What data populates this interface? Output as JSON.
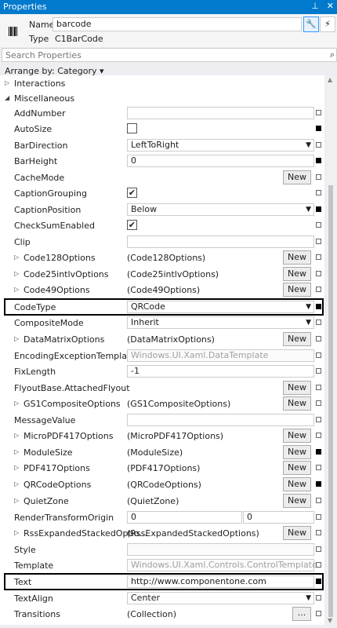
{
  "window": {
    "title": "Properties",
    "pin_icon": "pin-icon",
    "close_icon": "close-icon"
  },
  "header": {
    "name_label": "Name",
    "name_value": "barcode",
    "type_label": "Type",
    "type_value": "C1BarCode"
  },
  "search": {
    "placeholder": "Search Properties"
  },
  "arrange": {
    "label": "Arrange by: Category ▾"
  },
  "categories": {
    "interactions": "Interactions",
    "miscellaneous": "Miscellaneous"
  },
  "props": {
    "AddNumber": {
      "name": "AddNumber",
      "value": ""
    },
    "AutoSize": {
      "name": "AutoSize"
    },
    "BarDirection": {
      "name": "BarDirection",
      "value": "LeftToRight"
    },
    "BarHeight": {
      "name": "BarHeight",
      "value": "0"
    },
    "CacheMode": {
      "name": "CacheMode"
    },
    "CaptionGrouping": {
      "name": "CaptionGrouping"
    },
    "CaptionPosition": {
      "name": "CaptionPosition",
      "value": "Below"
    },
    "CheckSumEnabled": {
      "name": "CheckSumEnabled"
    },
    "Clip": {
      "name": "Clip",
      "value": ""
    },
    "Code128Options": {
      "name": "Code128Options",
      "value": "(Code128Options)"
    },
    "Code25intlvOptions": {
      "name": "Code25intlvOptions",
      "value": "(Code25intlvOptions)"
    },
    "Code49Options": {
      "name": "Code49Options",
      "value": "(Code49Options)"
    },
    "CodeType": {
      "name": "CodeType",
      "value": "QRCode"
    },
    "CompositeMode": {
      "name": "CompositeMode",
      "value": "Inherit"
    },
    "DataMatrixOptions": {
      "name": "DataMatrixOptions",
      "value": "(DataMatrixOptions)"
    },
    "EncodingExceptionTemplate": {
      "name": "EncodingExceptionTemplate",
      "value": "Windows.UI.Xaml.DataTemplate"
    },
    "FixLength": {
      "name": "FixLength",
      "value": "-1"
    },
    "FlyoutBase": {
      "name": "FlyoutBase.AttachedFlyout"
    },
    "GS1CompositeOptions": {
      "name": "GS1CompositeOptions",
      "value": "(GS1CompositeOptions)"
    },
    "MessageValue": {
      "name": "MessageValue",
      "value": ""
    },
    "MicroPDF417Options": {
      "name": "MicroPDF417Options",
      "value": "(MicroPDF417Options)"
    },
    "ModuleSize": {
      "name": "ModuleSize",
      "value": "(ModuleSize)"
    },
    "PDF417Options": {
      "name": "PDF417Options",
      "value": "(PDF417Options)"
    },
    "QRCodeOptions": {
      "name": "QRCodeOptions",
      "value": "(QRCodeOptions)"
    },
    "QuietZone": {
      "name": "QuietZone",
      "value": "(QuietZone)"
    },
    "RenderTransformOrigin": {
      "name": "RenderTransformOrigin",
      "x": "0",
      "y": "0"
    },
    "RssExpandedStackedOptions": {
      "name": "RssExpandedStackedOptio...",
      "value": "(RssExpandedStackedOptions)"
    },
    "Style": {
      "name": "Style",
      "value": ""
    },
    "Template": {
      "name": "Template",
      "value": "Windows.UI.Xaml.Controls.ControlTemplate"
    },
    "Text": {
      "name": "Text",
      "value": "http://www.componentone.com"
    },
    "TextAlign": {
      "name": "TextAlign",
      "value": "Center"
    },
    "Transitions": {
      "name": "Transitions",
      "value": "(Collection)"
    }
  },
  "buttons": {
    "new": "New",
    "ellipsis": "..."
  }
}
